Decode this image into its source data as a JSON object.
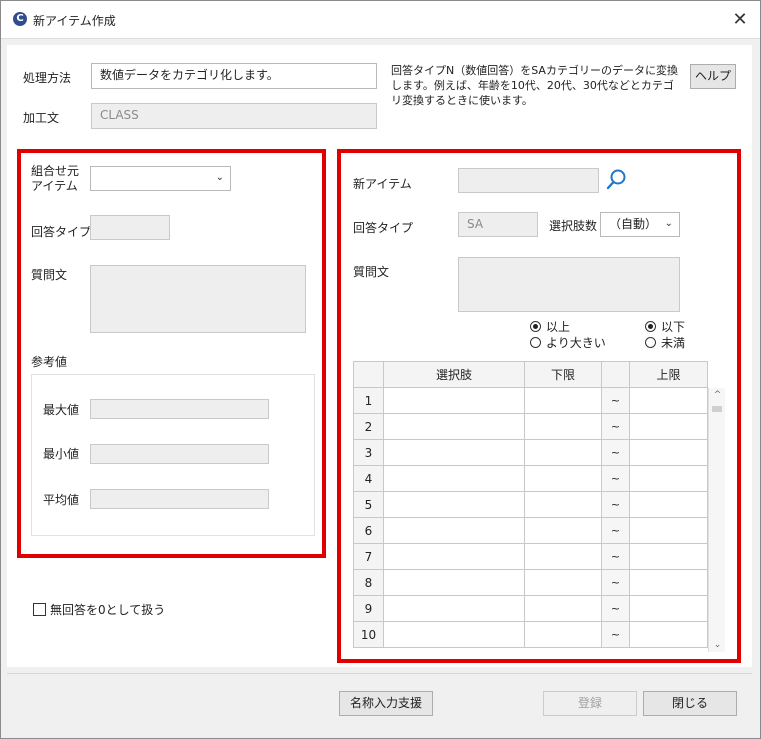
{
  "window": {
    "title": "新アイテム作成",
    "close_label": "✕"
  },
  "top": {
    "method_label": "処理方法",
    "method_value": "数値データをカテゴリ化します。",
    "process_label": "加工文",
    "process_value": "CLASS",
    "description": "回答タイプN（数値回答）をSAカテゴリーのデータに変換します。例えば、年齢を10代、20代、30代などとカテゴリ変換するときに使います。",
    "help_label": "ヘルプ"
  },
  "left_panel": {
    "source_item_label": "組合せ元アイテム",
    "source_item_value": "",
    "answer_type_label": "回答タイプ",
    "answer_type_value": "",
    "question_label": "質問文",
    "question_value": "",
    "reference_label": "参考値",
    "max_label": "最大値",
    "min_label": "最小値",
    "avg_label": "平均値",
    "max_value": "",
    "min_value": "",
    "avg_value": ""
  },
  "no_answer_zero_label": "無回答を0として扱う",
  "right_panel": {
    "new_item_label": "新アイテム",
    "new_item_value": "",
    "answer_type_label": "回答タイプ",
    "answer_type_value": "SA",
    "choice_count_label": "選択肢数",
    "choice_count_value": "（自動）",
    "question_label": "質問文",
    "question_value": "",
    "lower_options": [
      "以上",
      "より大きい"
    ],
    "upper_options": [
      "以下",
      "未満"
    ],
    "lower_selected": "以上",
    "upper_selected": "以下"
  },
  "grid": {
    "headers": [
      "",
      "選択肢",
      "下限",
      "",
      "上限"
    ],
    "rows": [
      {
        "num": "1",
        "choice": "",
        "lower": "",
        "tilde": "~",
        "upper": ""
      },
      {
        "num": "2",
        "choice": "",
        "lower": "",
        "tilde": "~",
        "upper": ""
      },
      {
        "num": "3",
        "choice": "",
        "lower": "",
        "tilde": "~",
        "upper": ""
      },
      {
        "num": "4",
        "choice": "",
        "lower": "",
        "tilde": "~",
        "upper": ""
      },
      {
        "num": "5",
        "choice": "",
        "lower": "",
        "tilde": "~",
        "upper": ""
      },
      {
        "num": "6",
        "choice": "",
        "lower": "",
        "tilde": "~",
        "upper": ""
      },
      {
        "num": "7",
        "choice": "",
        "lower": "",
        "tilde": "~",
        "upper": ""
      },
      {
        "num": "8",
        "choice": "",
        "lower": "",
        "tilde": "~",
        "upper": ""
      },
      {
        "num": "9",
        "choice": "",
        "lower": "",
        "tilde": "~",
        "upper": ""
      },
      {
        "num": "10",
        "choice": "",
        "lower": "",
        "tilde": "~",
        "upper": ""
      }
    ]
  },
  "footer": {
    "name_assist_label": "名称入力支援",
    "register_label": "登録",
    "close_label": "閉じる"
  },
  "icons": {
    "app": "app-logo-icon",
    "search": "search-icon",
    "close": "close-icon",
    "dropdown": "chevron-down-icon"
  },
  "colors": {
    "highlight": "#e00000",
    "app_icon": "#2f4d8f"
  }
}
